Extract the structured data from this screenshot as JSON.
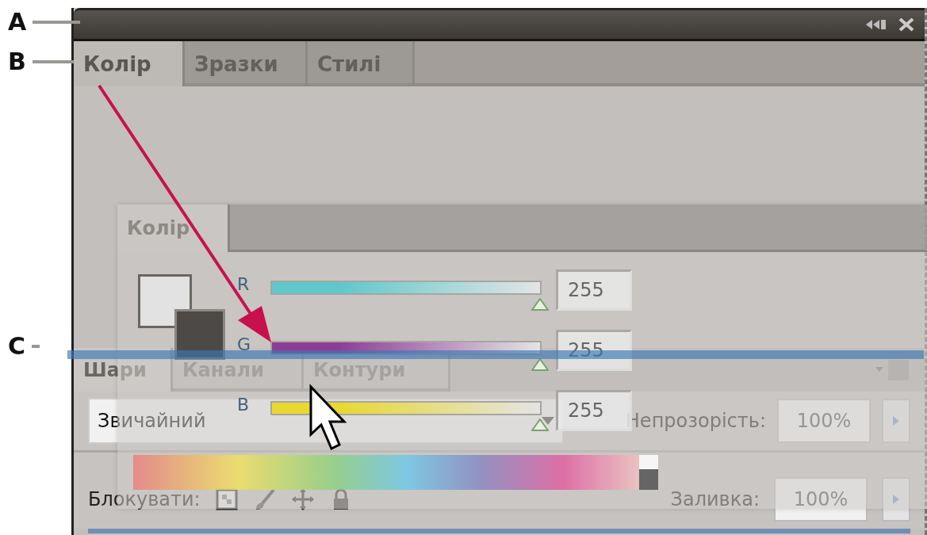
{
  "callouts": [
    {
      "label": "A"
    },
    {
      "label": "B"
    },
    {
      "label": "C"
    }
  ],
  "panel_group": {
    "tabs": [
      {
        "label": "Колір",
        "selected": true
      },
      {
        "label": "Зразки",
        "selected": false
      },
      {
        "label": "Стилі",
        "selected": false
      }
    ]
  },
  "layers_panel": {
    "tabs": [
      {
        "label": "Шари",
        "selected": true
      },
      {
        "label": "Канали",
        "selected": false
      },
      {
        "label": "Контури",
        "selected": false
      }
    ],
    "blend_mode": "Звичайний",
    "opacity_label": "Непрозорість:",
    "opacity": "100%",
    "lock_label": "Блокувати:",
    "fill_label": "Заливка:",
    "fill": "100%"
  },
  "floating_panel": {
    "tabs": [
      {
        "label": "Колір",
        "selected": true
      }
    ],
    "channels": [
      {
        "name": "R",
        "color": "#5ec8cc",
        "level": 1,
        "value": "255"
      },
      {
        "name": "G",
        "color": "#8e3d96",
        "level": 1,
        "value": "255"
      },
      {
        "name": "B",
        "color": "#e8d830",
        "level": 1,
        "value": "255"
      }
    ]
  }
}
